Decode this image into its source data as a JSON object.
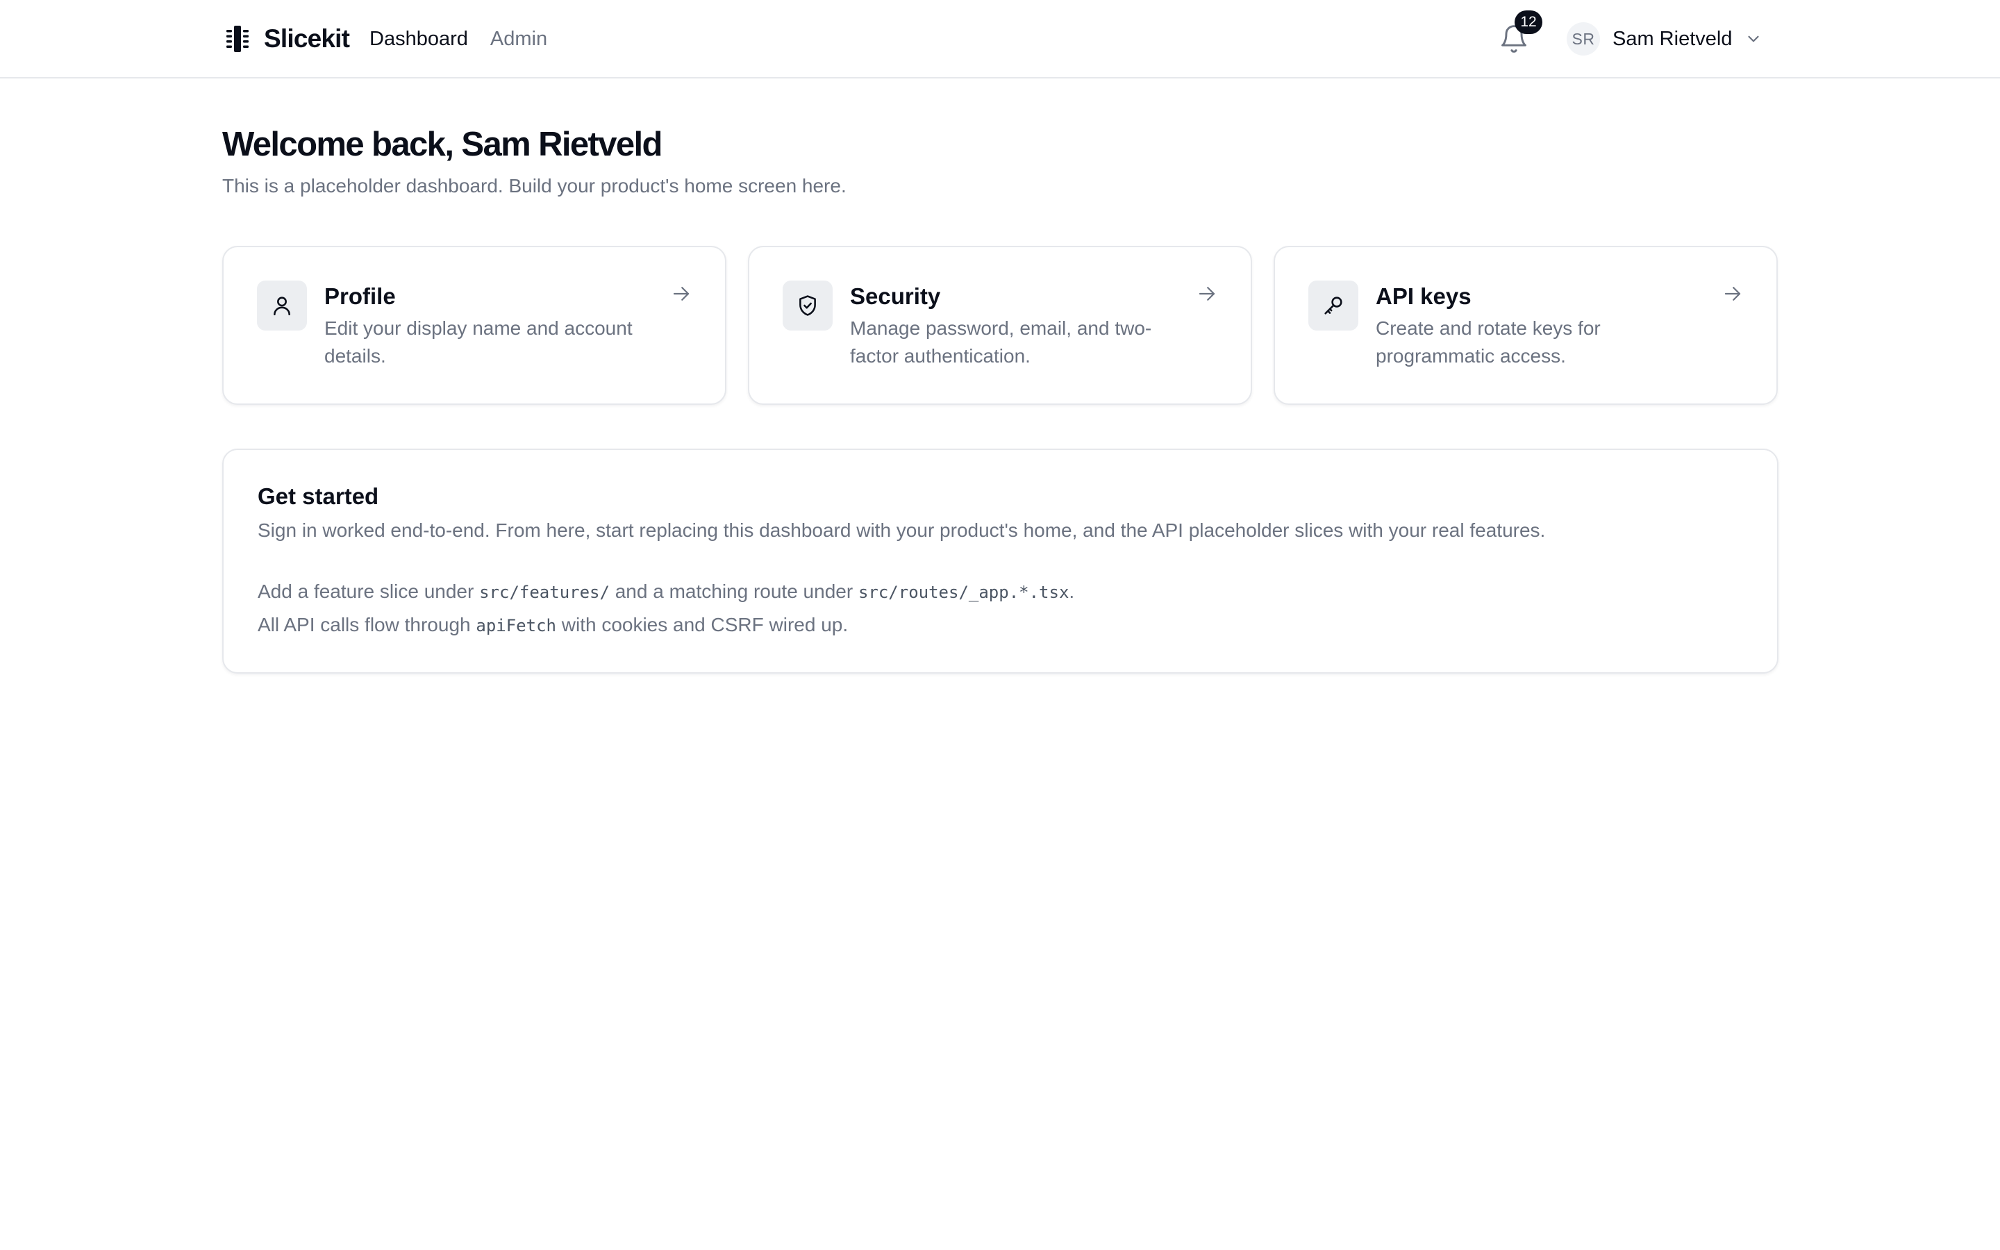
{
  "header": {
    "brand": "Slicekit",
    "nav": [
      {
        "label": "Dashboard",
        "active": true
      },
      {
        "label": "Admin",
        "active": false
      }
    ],
    "notifications_count": "12",
    "user": {
      "initials": "SR",
      "name": "Sam Rietveld"
    }
  },
  "main": {
    "welcome": "Welcome back, Sam Rietveld",
    "subtitle": "This is a placeholder dashboard. Build your product's home screen here.",
    "cards": [
      {
        "icon": "user-icon",
        "title": "Profile",
        "description": "Edit your display name and account details."
      },
      {
        "icon": "shield-check-icon",
        "title": "Security",
        "description": "Manage password, email, and two-factor authentication."
      },
      {
        "icon": "key-icon",
        "title": "API keys",
        "description": "Create and rotate keys for programmatic access."
      }
    ],
    "get_started": {
      "title": "Get started",
      "intro": "Sign in worked end-to-end. From here, start replacing this dashboard with your product's home, and the API placeholder slices with your real features.",
      "line2_a": "Add a feature slice under ",
      "line2_code1": "src/features/",
      "line2_b": " and a matching route under ",
      "line2_code2": "src/routes/_app.*.tsx",
      "line2_c": ".",
      "line3_a": "All API calls flow through ",
      "line3_code": "apiFetch",
      "line3_b": " with cookies and CSRF wired up."
    }
  },
  "colors": {
    "text": "#0b0f1a",
    "muted": "#6b7280",
    "border": "#e6e8ec",
    "icon_bg": "#eceef1"
  }
}
